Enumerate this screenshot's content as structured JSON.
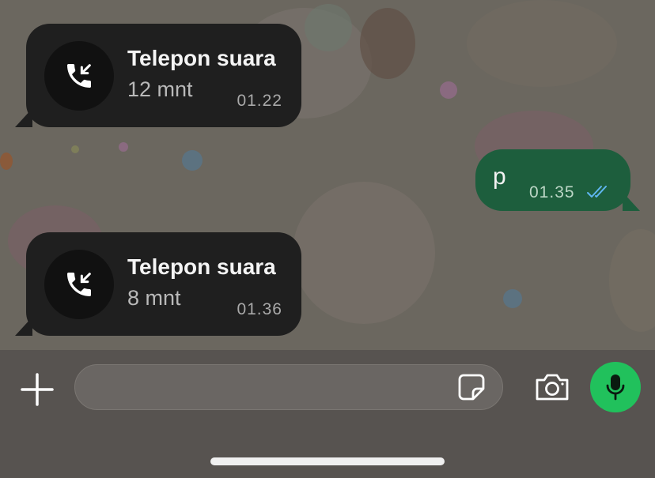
{
  "messages": [
    {
      "type": "call",
      "direction": "incoming",
      "title": "Telepon suara",
      "duration": "12 mnt",
      "time": "01.22"
    },
    {
      "type": "text",
      "direction": "outgoing",
      "text": "p",
      "time": "01.35",
      "status": "read"
    },
    {
      "type": "call",
      "direction": "incoming",
      "title": "Telepon suara",
      "duration": "8 mnt",
      "time": "01.36"
    }
  ],
  "input": {
    "value": "",
    "placeholder": ""
  },
  "icons": {
    "attach": "plus-icon",
    "sticker": "sticker-icon",
    "camera": "camera-icon",
    "voice": "microphone-icon",
    "call": "incoming-call-icon",
    "read_receipt": "double-check-icon"
  },
  "colors": {
    "incoming_bubble": "#1f1f1f",
    "outgoing_bubble": "#1d5e3d",
    "read_ticks": "#5fb6f0",
    "mic_button": "#21c15c"
  }
}
